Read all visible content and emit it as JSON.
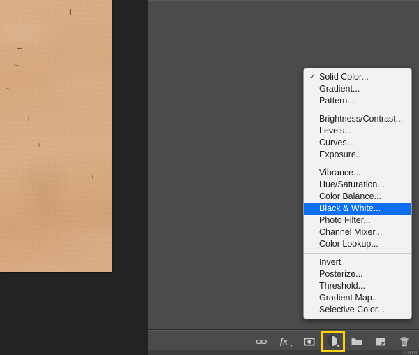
{
  "document": {
    "image_name": "kraft-paper-texture"
  },
  "menu": {
    "name": "adjustment-layer-menu",
    "groups": [
      {
        "items": [
          {
            "label": "Solid Color...",
            "checked": true,
            "highlighted": false
          },
          {
            "label": "Gradient...",
            "checked": false,
            "highlighted": false
          },
          {
            "label": "Pattern...",
            "checked": false,
            "highlighted": false
          }
        ]
      },
      {
        "items": [
          {
            "label": "Brightness/Contrast...",
            "checked": false,
            "highlighted": false
          },
          {
            "label": "Levels...",
            "checked": false,
            "highlighted": false
          },
          {
            "label": "Curves...",
            "checked": false,
            "highlighted": false
          },
          {
            "label": "Exposure...",
            "checked": false,
            "highlighted": false
          }
        ]
      },
      {
        "items": [
          {
            "label": "Vibrance...",
            "checked": false,
            "highlighted": false
          },
          {
            "label": "Hue/Saturation...",
            "checked": false,
            "highlighted": false
          },
          {
            "label": "Color Balance...",
            "checked": false,
            "highlighted": false
          },
          {
            "label": "Black & White...",
            "checked": false,
            "highlighted": true
          },
          {
            "label": "Photo Filter...",
            "checked": false,
            "highlighted": false
          },
          {
            "label": "Channel Mixer...",
            "checked": false,
            "highlighted": false
          },
          {
            "label": "Color Lookup...",
            "checked": false,
            "highlighted": false
          }
        ]
      },
      {
        "items": [
          {
            "label": "Invert",
            "checked": false,
            "highlighted": false
          },
          {
            "label": "Posterize...",
            "checked": false,
            "highlighted": false
          },
          {
            "label": "Threshold...",
            "checked": false,
            "highlighted": false
          },
          {
            "label": "Gradient Map...",
            "checked": false,
            "highlighted": false
          },
          {
            "label": "Selective Color...",
            "checked": false,
            "highlighted": false
          }
        ]
      }
    ],
    "checkmark_glyph": "✓"
  },
  "layer_toolbar": {
    "buttons": [
      {
        "icon": "link-layers-icon",
        "label": "Link layers",
        "selected": false
      },
      {
        "icon": "layer-style-fx-icon",
        "label": "Add a layer style",
        "selected": false
      },
      {
        "icon": "layer-mask-icon",
        "label": "Add layer mask",
        "selected": false
      },
      {
        "icon": "new-adjustment-layer-icon",
        "label": "Create new fill or adjustment layer",
        "selected": true
      },
      {
        "icon": "new-group-folder-icon",
        "label": "Create a new group",
        "selected": false
      },
      {
        "icon": "new-layer-icon",
        "label": "Create a new layer",
        "selected": false
      },
      {
        "icon": "delete-layer-trash-icon",
        "label": "Delete layer",
        "selected": false
      }
    ]
  },
  "colors": {
    "menu_highlight": "#0b6ff0",
    "selection_outline": "#ffd20a",
    "panel_background": "#4b4b4b",
    "canvas_background": "#232323",
    "menu_background": "#f2f2f2",
    "icon_color": "#c8c8c8",
    "paper_tone": "#d9ab81"
  }
}
